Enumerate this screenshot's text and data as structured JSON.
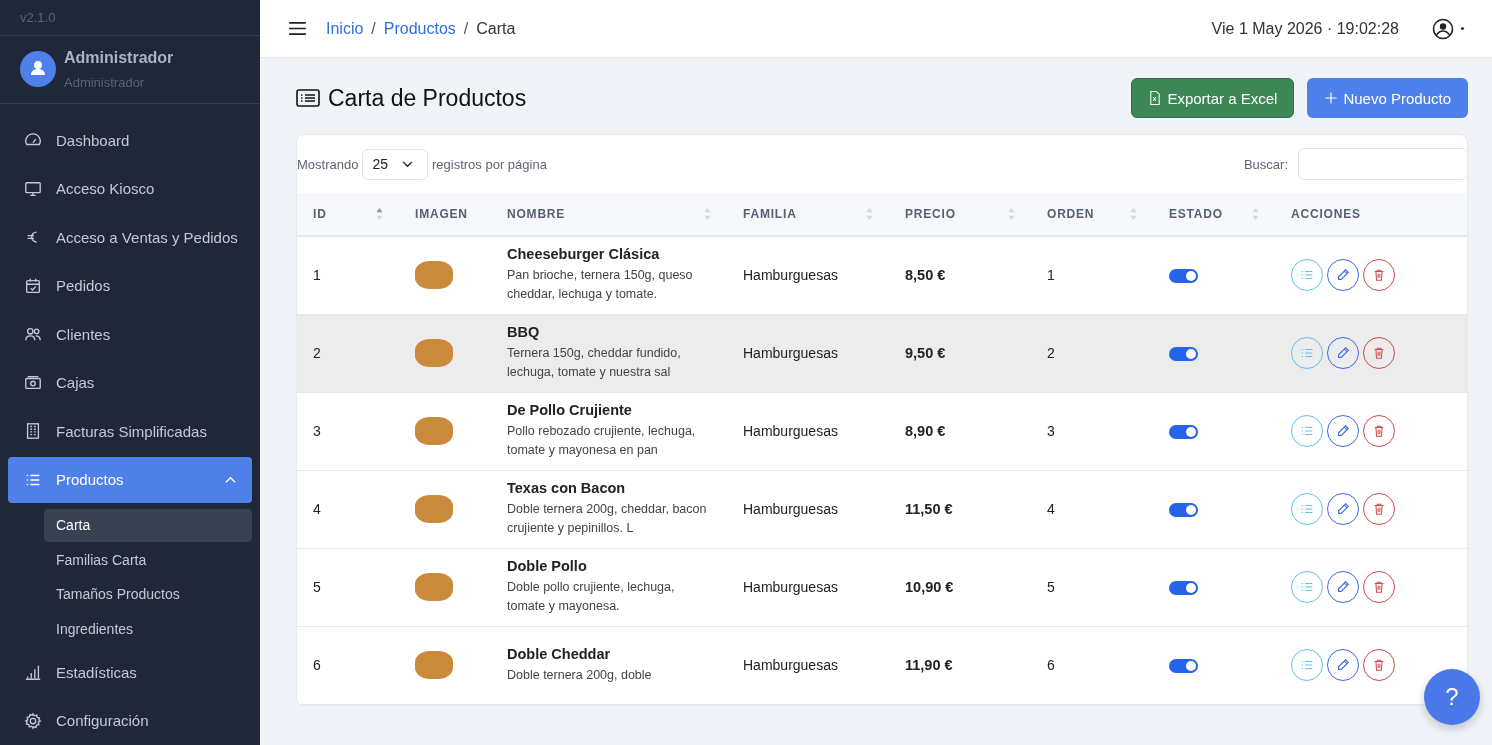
{
  "sidebar": {
    "version": "v2.1.0",
    "user": {
      "name": "Administrador",
      "role": "Administrador"
    },
    "items": [
      {
        "label": "Dashboard",
        "selected": false
      },
      {
        "label": "Acceso Kiosco",
        "selected": false
      },
      {
        "label": "Acceso a Ventas y Pedidos",
        "selected": false
      },
      {
        "label": "Pedidos",
        "selected": false
      },
      {
        "label": "Clientes",
        "selected": false
      },
      {
        "label": "Cajas",
        "selected": false
      },
      {
        "label": "Facturas Simplificadas",
        "selected": false
      },
      {
        "label": "Productos",
        "selected": true,
        "expanded": true,
        "children": [
          {
            "label": "Carta",
            "selected": true
          },
          {
            "label": "Familias Carta",
            "selected": false
          },
          {
            "label": "Tamaños Productos",
            "selected": false
          },
          {
            "label": "Ingredientes",
            "selected": false
          }
        ]
      },
      {
        "label": "Estadísticas",
        "selected": false
      },
      {
        "label": "Configuración",
        "selected": false
      }
    ]
  },
  "topbar": {
    "breadcrumb": [
      {
        "label": "Inicio",
        "link": true
      },
      {
        "label": "Productos",
        "link": true
      },
      {
        "label": "Carta",
        "link": false
      }
    ],
    "separator": "/",
    "datetime": "Vie 1 May 2026 · 19:02:28"
  },
  "page": {
    "title": "Carta de Productos",
    "buttons": [
      {
        "label": "Exportar a Excel",
        "kind": "excel"
      },
      {
        "label": "Nuevo Producto",
        "kind": "new"
      }
    ]
  },
  "table": {
    "length_label_before": "Mostrando",
    "length_value": "25",
    "length_label_after": "registros por página",
    "search_label": "Buscar:",
    "columns": [
      {
        "label": "ID",
        "sortable": true,
        "sorted": true
      },
      {
        "label": "IMAGEN",
        "sortable": false
      },
      {
        "label": "NOMBRE",
        "sortable": true,
        "sorted": false
      },
      {
        "label": "FAMILIA",
        "sortable": true,
        "sorted": false
      },
      {
        "label": "PRECIO",
        "sortable": true,
        "sorted": false
      },
      {
        "label": "ORDEN",
        "sortable": true,
        "sorted": false
      },
      {
        "label": "ESTADO",
        "sortable": true,
        "sorted": false
      },
      {
        "label": "ACCIONES",
        "sortable": false
      }
    ],
    "rows": [
      {
        "id": "1",
        "name": "Cheeseburger Clásica",
        "description": "Pan brioche, ternera 150g, queso cheddar, lechuga y tomate.",
        "family": "Hamburguesas",
        "price": "8,50 €",
        "order": "1",
        "active": true,
        "selected": false
      },
      {
        "id": "2",
        "name": "BBQ",
        "description": "Ternera 150g, cheddar fundido, lechuga, tomate y nuestra sal",
        "family": "Hamburguesas",
        "price": "9,50 €",
        "order": "2",
        "active": true,
        "selected": true
      },
      {
        "id": "3",
        "name": "De Pollo Crujiente",
        "description": "Pollo rebozado crujiente, lechuga, tomate y mayonesa en pan",
        "family": "Hamburguesas",
        "price": "8,90 €",
        "order": "3",
        "active": true,
        "selected": false
      },
      {
        "id": "4",
        "name": "Texas con Bacon",
        "description": "Doble ternera 200g, cheddar, bacon crujiente y pepinillos. L",
        "family": "Hamburguesas",
        "price": "11,50 €",
        "order": "4",
        "active": true,
        "selected": false
      },
      {
        "id": "5",
        "name": "Doble Pollo",
        "description": "Doble pollo crujiente, lechuga, tomate y mayonesa.",
        "family": "Hamburguesas",
        "price": "10,90 €",
        "order": "5",
        "active": true,
        "selected": false
      },
      {
        "id": "6",
        "name": "Doble Cheddar",
        "description": "Doble ternera 200g, doble",
        "family": "Hamburguesas",
        "price": "11,90 €",
        "order": "6",
        "active": true,
        "selected": false
      }
    ]
  },
  "help_button": {
    "label": "?"
  }
}
